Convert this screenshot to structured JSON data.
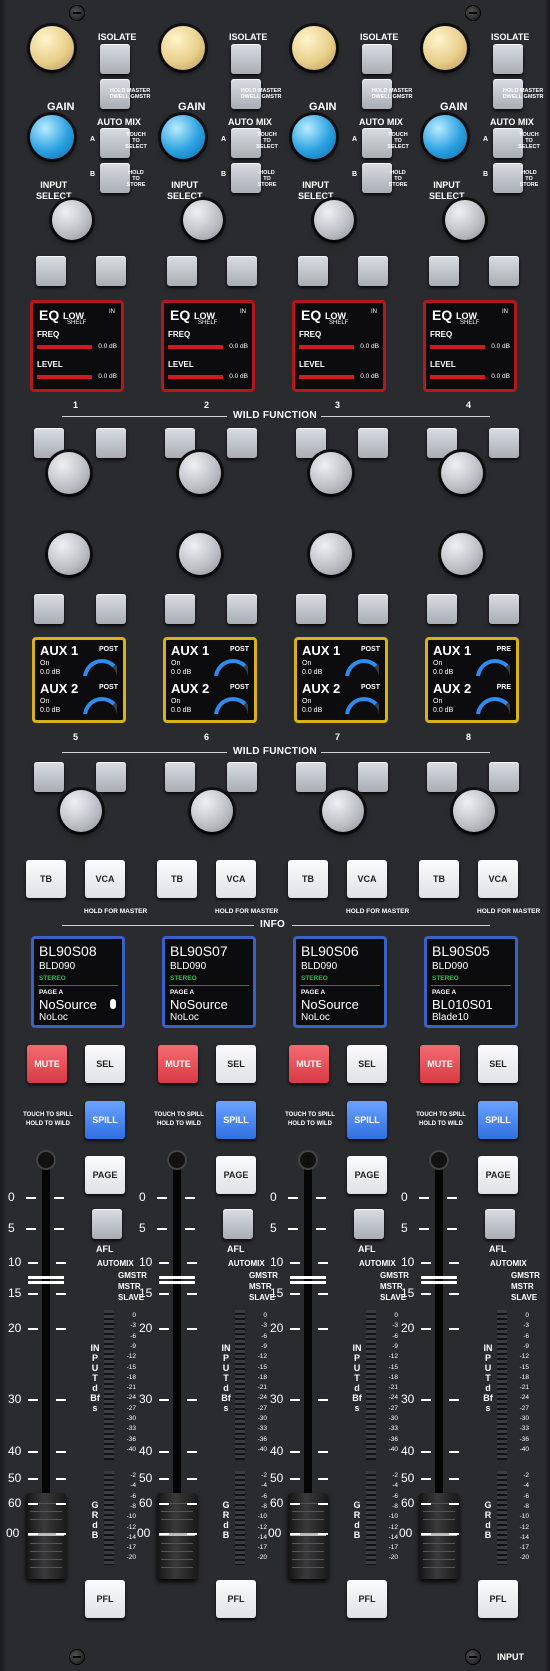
{
  "labels": {
    "isolate": "ISOLATE",
    "hold_master_dwell_gmstr": "HOLD MASTER\nDWELL GMSTR",
    "gain": "GAIN",
    "auto_mix": "AUTO MIX",
    "a": "A",
    "b": "B",
    "touch_to_select": "TOUCH\nTO\nSELECT",
    "hold_to_store": "HOLD\nTO\nSTORE",
    "input_select": "INPUT\nSELECT",
    "wild_function": "WILD FUNCTION",
    "info": "INFO",
    "tb": "TB",
    "vca": "VCA",
    "hold_for_master": "HOLD FOR MASTER",
    "mute": "MUTE",
    "sel": "SEL",
    "spill": "SPILL",
    "touch_to_spill": "TOUCH TO SPILL\nHOLD TO WILD",
    "page": "PAGE",
    "afl": "AFL",
    "automix": "AUTOMIX",
    "gmstr": "GMSTR",
    "mstr": "MSTR",
    "slave": "SLAVE",
    "input_dbfs": "INPUT dBfs",
    "gr_db": "GR dB",
    "pfl": "PFL",
    "input": "INPUT"
  },
  "fader_scale": [
    "0",
    "5",
    "10",
    "15",
    "20",
    "30",
    "40",
    "50",
    "60",
    "00"
  ],
  "input_meter_scale": [
    "0",
    "-3",
    "-6",
    "-9",
    "-12",
    "-15",
    "-18",
    "-21",
    "-24",
    "-27",
    "-30",
    "-33",
    "-36",
    "-40"
  ],
  "gr_meter_scale": [
    "-2",
    "-4",
    "-6",
    "-8",
    "-10",
    "-12",
    "-14",
    "-17",
    "-20"
  ],
  "channels": [
    {
      "number": "1",
      "eq": {
        "title": "EQ",
        "band": "LOW",
        "type": "SHELF",
        "state": "IN",
        "freq_label": "FREQ",
        "freq_value": "0.0 dB",
        "level_label": "LEVEL",
        "level_value": "0.0 dB"
      },
      "aux": [
        {
          "name": "AUX 1",
          "mode": "POST",
          "state": "On",
          "level": "0.0 dB"
        },
        {
          "name": "AUX 2",
          "mode": "POST",
          "state": "On",
          "level": "0.0 dB"
        }
      ],
      "number2": "5",
      "info": {
        "name": "BL90S08",
        "device": "BLD090",
        "format": "STEREO",
        "page": "PAGE A",
        "source": "NoSource",
        "location": "NoLoc"
      }
    },
    {
      "number": "2",
      "eq": {
        "title": "EQ",
        "band": "LOW",
        "type": "SHELF",
        "state": "IN",
        "freq_label": "FREQ",
        "freq_value": "0.0 dB",
        "level_label": "LEVEL",
        "level_value": "0.0 dB"
      },
      "aux": [
        {
          "name": "AUX 1",
          "mode": "POST",
          "state": "On",
          "level": "0.0 dB"
        },
        {
          "name": "AUX 2",
          "mode": "POST",
          "state": "On",
          "level": "0.0 dB"
        }
      ],
      "number2": "6",
      "info": {
        "name": "BL90S07",
        "device": "BLD090",
        "format": "STEREO",
        "page": "PAGE A",
        "source": "NoSource",
        "location": "NoLoc"
      }
    },
    {
      "number": "3",
      "eq": {
        "title": "EQ",
        "band": "LOW",
        "type": "SHELF",
        "state": "IN",
        "freq_label": "FREQ",
        "freq_value": "0.0 dB",
        "level_label": "LEVEL",
        "level_value": "0.0 dB"
      },
      "aux": [
        {
          "name": "AUX 1",
          "mode": "POST",
          "state": "On",
          "level": "0.0 dB"
        },
        {
          "name": "AUX 2",
          "mode": "POST",
          "state": "On",
          "level": "0.0 dB"
        }
      ],
      "number2": "7",
      "info": {
        "name": "BL90S06",
        "device": "BLD090",
        "format": "STEREO",
        "page": "PAGE A",
        "source": "NoSource",
        "location": "NoLoc"
      }
    },
    {
      "number": "4",
      "eq": {
        "title": "EQ",
        "band": "LOW",
        "type": "SHELF",
        "state": "IN",
        "freq_label": "FREQ",
        "freq_value": "0.0 dB",
        "level_label": "LEVEL",
        "level_value": "0.0 dB"
      },
      "aux": [
        {
          "name": "AUX 1",
          "mode": "PRE",
          "state": "On",
          "level": "0.0 dB"
        },
        {
          "name": "AUX 2",
          "mode": "PRE",
          "state": "On",
          "level": "0.0 dB"
        }
      ],
      "number2": "8",
      "info": {
        "name": "BL90S05",
        "device": "BLD090",
        "format": "STEREO",
        "page": "PAGE A",
        "source": "BL010S01",
        "location": "Blade10"
      }
    }
  ]
}
